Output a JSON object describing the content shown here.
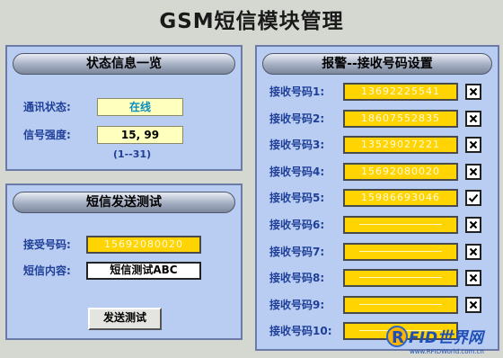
{
  "title": "GSM短信模块管理",
  "status_panel": {
    "header": "状态信息一览",
    "comm_label": "通讯状态:",
    "comm_value": "在线",
    "signal_label": "信号强度:",
    "signal_value": "15, 99",
    "signal_range": "(1--31)"
  },
  "sms_panel": {
    "header": "短信发送测试",
    "receiver_label": "接受号码:",
    "receiver_value": "15692080020",
    "content_label": "短信内容:",
    "content_value": "短信测试ABC",
    "send_button": "发送测试"
  },
  "alarm_panel": {
    "header": "报警--接收号码设置",
    "rows": [
      {
        "label": "接收号码1:",
        "value": "13692225541",
        "action": "close-icon"
      },
      {
        "label": "接收号码2:",
        "value": "18607552835",
        "action": "close-icon"
      },
      {
        "label": "接收号码3:",
        "value": "13529027221",
        "action": "close-icon"
      },
      {
        "label": "接收号码4:",
        "value": "15692080020",
        "action": "close-icon"
      },
      {
        "label": "接收号码5:",
        "value": "15986693046",
        "action": "check-icon"
      },
      {
        "label": "接收号码6:",
        "value": "",
        "action": "close-icon"
      },
      {
        "label": "接收号码7:",
        "value": "",
        "action": "close-icon"
      },
      {
        "label": "接收号码8:",
        "value": "",
        "action": "close-icon"
      },
      {
        "label": "接收号码9:",
        "value": "",
        "action": "close-icon"
      },
      {
        "label": "接收号码10:",
        "value": "",
        "action": ""
      }
    ]
  },
  "watermark": {
    "brand": "RFID世界网",
    "url": "www.RFIDWorld.com.cn"
  },
  "colors": {
    "panel_bg": "#b9cdf2",
    "label_blue": "#1f3f98",
    "number_yellow": "#ffd400",
    "light_field": "#ffffbe"
  }
}
